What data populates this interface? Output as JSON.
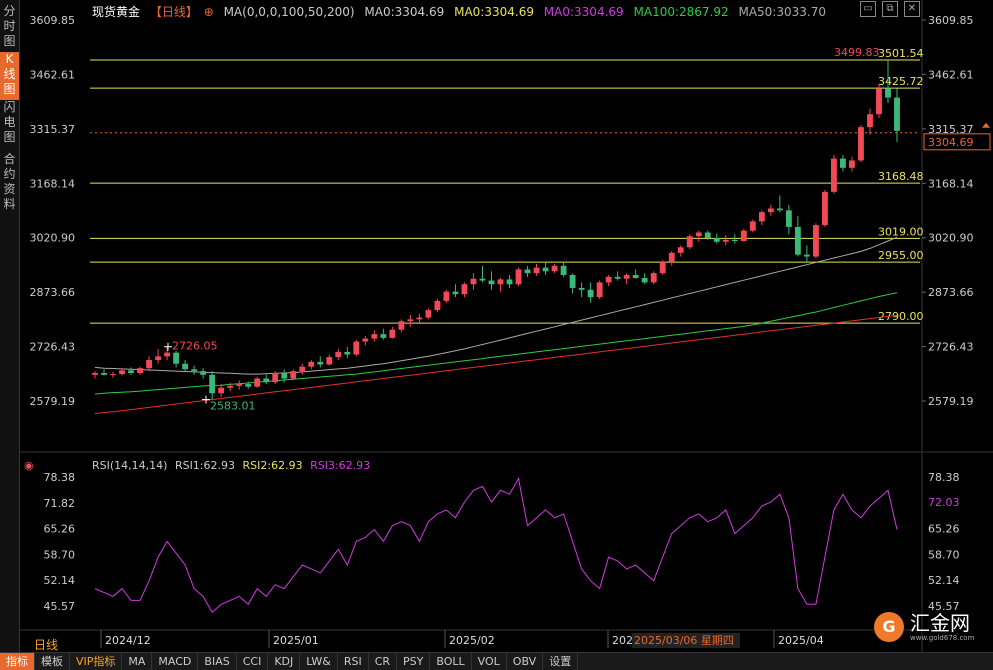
{
  "sidebar": {
    "tabs": [
      {
        "label": [
          "分",
          "时",
          "图"
        ],
        "active": false
      },
      {
        "label": [
          "K",
          "线",
          "图"
        ],
        "active": true
      },
      {
        "label": [
          "闪",
          "电",
          "图"
        ],
        "active": false
      },
      {
        "label": [
          "合",
          "约",
          "资",
          "料"
        ],
        "active": false
      }
    ]
  },
  "header": {
    "title": "现货黄金",
    "period": "【日线】",
    "ma_label": "MA(0,0,0,100,50,200)",
    "ma0": "MA0:3304.69",
    "ma0_yellow": "MA0:3304.69",
    "ma0_magenta": "MA0:3304.69",
    "ma100": "MA100:2867.92",
    "ma50": "MA50:3033.70"
  },
  "rsi_header": {
    "label": "RSI(14,14,14)",
    "rsi1": "RSI1:62.93",
    "rsi2": "RSI2:62.93",
    "rsi3": "RSI3:62.93"
  },
  "price_axis": [
    "3609.85",
    "3462.61",
    "3315.37",
    "3168.14",
    "3020.90",
    "2873.66",
    "2726.43",
    "2579.19"
  ],
  "rsi_axis": [
    "78.38",
    "71.82",
    "65.26",
    "58.70",
    "52.14",
    "45.57"
  ],
  "current_price": "3304.69",
  "current_rsi": "72.03",
  "date_axis": [
    "2024/12",
    "2025/01",
    "2025/02",
    "202",
    "2025/04"
  ],
  "crosshair_date": "2025/03/06 星期四",
  "levels": [
    "3501.54",
    "3425.72",
    "3168.48",
    "3019.00",
    "2955.00",
    "2790.00"
  ],
  "annotations": {
    "high_label": "2726.05",
    "low_label": "2583.01",
    "peak_label": "3499.83"
  },
  "period_label": "日线",
  "logo": {
    "name": "汇金网",
    "url": "www.gold678.com"
  },
  "bottom_bar": [
    "指标",
    "模板",
    "VIP指标",
    "MA",
    "MACD",
    "BIAS",
    "CCI",
    "KDJ",
    "LW&",
    "RSI",
    "CR",
    "PSY",
    "BOLL",
    "VOL",
    "OBV",
    "设置"
  ],
  "colors": {
    "up": "#f24957",
    "down": "#3bb87a",
    "level": "#e8e35a",
    "ma100": "#2ecc40",
    "ma200": "#e03030",
    "ma50": "#aaaaaa",
    "rsi": "#d13be0"
  },
  "chart_data": {
    "type": "candlestick",
    "candles": [
      [
        2650,
        2660,
        2640,
        2655
      ],
      [
        2655,
        2665,
        2648,
        2650
      ],
      [
        2650,
        2658,
        2642,
        2652
      ],
      [
        2652,
        2668,
        2648,
        2662
      ],
      [
        2662,
        2670,
        2650,
        2655
      ],
      [
        2655,
        2672,
        2650,
        2668
      ],
      [
        2668,
        2700,
        2660,
        2690
      ],
      [
        2690,
        2720,
        2680,
        2700
      ],
      [
        2700,
        2726,
        2690,
        2710
      ],
      [
        2710,
        2715,
        2670,
        2680
      ],
      [
        2680,
        2690,
        2660,
        2665
      ],
      [
        2665,
        2675,
        2650,
        2660
      ],
      [
        2660,
        2668,
        2640,
        2650
      ],
      [
        2650,
        2660,
        2583,
        2600
      ],
      [
        2600,
        2625,
        2590,
        2615
      ],
      [
        2615,
        2628,
        2605,
        2620
      ],
      [
        2620,
        2635,
        2610,
        2625
      ],
      [
        2625,
        2632,
        2612,
        2618
      ],
      [
        2618,
        2645,
        2615,
        2640
      ],
      [
        2640,
        2650,
        2625,
        2630
      ],
      [
        2630,
        2660,
        2625,
        2655
      ],
      [
        2655,
        2665,
        2630,
        2640
      ],
      [
        2640,
        2665,
        2635,
        2660
      ],
      [
        2660,
        2680,
        2650,
        2672
      ],
      [
        2672,
        2690,
        2665,
        2685
      ],
      [
        2685,
        2700,
        2670,
        2678
      ],
      [
        2678,
        2705,
        2675,
        2698
      ],
      [
        2698,
        2720,
        2690,
        2712
      ],
      [
        2712,
        2725,
        2695,
        2705
      ],
      [
        2705,
        2745,
        2700,
        2740
      ],
      [
        2740,
        2755,
        2730,
        2748
      ],
      [
        2748,
        2770,
        2740,
        2760
      ],
      [
        2760,
        2775,
        2745,
        2750
      ],
      [
        2750,
        2780,
        2748,
        2772
      ],
      [
        2772,
        2800,
        2765,
        2795
      ],
      [
        2795,
        2812,
        2780,
        2800
      ],
      [
        2800,
        2815,
        2790,
        2805
      ],
      [
        2805,
        2830,
        2800,
        2825
      ],
      [
        2825,
        2855,
        2820,
        2850
      ],
      [
        2850,
        2880,
        2845,
        2875
      ],
      [
        2875,
        2895,
        2860,
        2868
      ],
      [
        2868,
        2900,
        2860,
        2895
      ],
      [
        2895,
        2925,
        2880,
        2910
      ],
      [
        2910,
        2945,
        2900,
        2905
      ],
      [
        2905,
        2930,
        2880,
        2895
      ],
      [
        2895,
        2912,
        2875,
        2908
      ],
      [
        2908,
        2920,
        2885,
        2895
      ],
      [
        2895,
        2940,
        2890,
        2935
      ],
      [
        2935,
        2945,
        2915,
        2925
      ],
      [
        2925,
        2950,
        2918,
        2940
      ],
      [
        2940,
        2955,
        2920,
        2930
      ],
      [
        2930,
        2950,
        2925,
        2945
      ],
      [
        2945,
        2955,
        2915,
        2920
      ],
      [
        2920,
        2925,
        2870,
        2885
      ],
      [
        2885,
        2900,
        2860,
        2880
      ],
      [
        2880,
        2900,
        2845,
        2860
      ],
      [
        2860,
        2905,
        2855,
        2900
      ],
      [
        2900,
        2920,
        2890,
        2915
      ],
      [
        2915,
        2930,
        2905,
        2910
      ],
      [
        2910,
        2925,
        2895,
        2920
      ],
      [
        2920,
        2935,
        2910,
        2912
      ],
      [
        2912,
        2925,
        2895,
        2900
      ],
      [
        2900,
        2930,
        2895,
        2925
      ],
      [
        2925,
        2960,
        2920,
        2955
      ],
      [
        2955,
        2985,
        2945,
        2980
      ],
      [
        2980,
        3000,
        2970,
        2995
      ],
      [
        2995,
        3030,
        2990,
        3025
      ],
      [
        3025,
        3040,
        3010,
        3035
      ],
      [
        3035,
        3040,
        3015,
        3020
      ],
      [
        3020,
        3032,
        3005,
        3010
      ],
      [
        3010,
        3028,
        3000,
        3015
      ],
      [
        3015,
        3030,
        3005,
        3012
      ],
      [
        3012,
        3045,
        3010,
        3040
      ],
      [
        3040,
        3070,
        3035,
        3065
      ],
      [
        3065,
        3095,
        3055,
        3090
      ],
      [
        3090,
        3110,
        3080,
        3100
      ],
      [
        3100,
        3135,
        3090,
        3095
      ],
      [
        3095,
        3110,
        3030,
        3050
      ],
      [
        3050,
        3080,
        2970,
        2975
      ],
      [
        2975,
        3000,
        2955,
        2970
      ],
      [
        2970,
        3060,
        2965,
        3055
      ],
      [
        3055,
        3150,
        3050,
        3145
      ],
      [
        3145,
        3245,
        3140,
        3235
      ],
      [
        3235,
        3245,
        3200,
        3210
      ],
      [
        3210,
        3240,
        3200,
        3230
      ],
      [
        3230,
        3325,
        3225,
        3320
      ],
      [
        3320,
        3370,
        3300,
        3355
      ],
      [
        3355,
        3435,
        3345,
        3425
      ],
      [
        3425,
        3500,
        3385,
        3400
      ],
      [
        3400,
        3425,
        3280,
        3310
      ]
    ],
    "ma200": [
      2545,
      2548,
      2550,
      2553,
      2556,
      2559,
      2562,
      2565,
      2568,
      2571,
      2574,
      2577,
      2580,
      2583,
      2586,
      2589,
      2592,
      2595,
      2598,
      2601,
      2604,
      2607,
      2610,
      2613,
      2616,
      2619,
      2622,
      2625,
      2628,
      2631,
      2634,
      2637,
      2640,
      2643,
      2646,
      2649,
      2652,
      2655,
      2658,
      2661,
      2664,
      2667,
      2670,
      2673,
      2676,
      2679,
      2682,
      2685,
      2688,
      2691,
      2694,
      2697,
      2700,
      2703,
      2706,
      2709,
      2712,
      2715,
      2718,
      2721,
      2724,
      2727,
      2730,
      2733,
      2736,
      2739,
      2742,
      2745,
      2748,
      2751,
      2754,
      2757,
      2760,
      2763,
      2766,
      2769,
      2772,
      2775,
      2778,
      2781,
      2784,
      2787,
      2790,
      2793,
      2796,
      2799,
      2802,
      2805,
      2808,
      2811
    ],
    "ma100": [
      2598,
      2600,
      2602,
      2603,
      2604,
      2606,
      2608,
      2610,
      2612,
      2614,
      2616,
      2618,
      2620,
      2621,
      2622,
      2624,
      2626,
      2628,
      2630,
      2632,
      2634,
      2636,
      2638,
      2640,
      2642,
      2644,
      2646,
      2648,
      2650,
      2652,
      2655,
      2658,
      2661,
      2664,
      2667,
      2670,
      2673,
      2676,
      2679,
      2682,
      2685,
      2688,
      2691,
      2694,
      2697,
      2700,
      2703,
      2706,
      2709,
      2712,
      2715,
      2718,
      2721,
      2724,
      2727,
      2730,
      2733,
      2736,
      2739,
      2742,
      2745,
      2748,
      2751,
      2754,
      2757,
      2760,
      2763,
      2766,
      2769,
      2772,
      2775,
      2778,
      2781,
      2785,
      2790,
      2795,
      2800,
      2805,
      2810,
      2815,
      2820,
      2826,
      2832,
      2838,
      2844,
      2850,
      2856,
      2862,
      2867,
      2872
    ],
    "ma50": [
      2670,
      2668,
      2667,
      2666,
      2665,
      2664,
      2663,
      2662,
      2661,
      2660,
      2659,
      2658,
      2657,
      2656,
      2655,
      2654,
      2653,
      2652,
      2652,
      2653,
      2654,
      2655,
      2656,
      2658,
      2660,
      2662,
      2664,
      2666,
      2668,
      2671,
      2674,
      2677,
      2680,
      2684,
      2688,
      2692,
      2696,
      2700,
      2705,
      2710,
      2715,
      2720,
      2726,
      2732,
      2738,
      2744,
      2750,
      2756,
      2762,
      2768,
      2774,
      2780,
      2786,
      2792,
      2798,
      2804,
      2810,
      2816,
      2822,
      2828,
      2834,
      2840,
      2846,
      2852,
      2858,
      2864,
      2870,
      2876,
      2882,
      2888,
      2894,
      2900,
      2906,
      2912,
      2918,
      2924,
      2930,
      2936,
      2942,
      2948,
      2954,
      2960,
      2966,
      2972,
      2978,
      2984,
      2992,
      3002,
      3012,
      3022
    ],
    "rsi": [
      50,
      49,
      48,
      50,
      47,
      47,
      52,
      58,
      62,
      59,
      56,
      50,
      48,
      44,
      46,
      47,
      48,
      46,
      50,
      48,
      51,
      50,
      53,
      56,
      55,
      54,
      57,
      60,
      56,
      62,
      63,
      65,
      62,
      66,
      67,
      66,
      62,
      67,
      69,
      70,
      68,
      72,
      75,
      76,
      72,
      75,
      74,
      78,
      66,
      68,
      70,
      68,
      69,
      62,
      55,
      52,
      50,
      58,
      57,
      55,
      56,
      54,
      52,
      58,
      64,
      66,
      68,
      69,
      67,
      68,
      70,
      64,
      66,
      68,
      71,
      72,
      74,
      68,
      50,
      46,
      46,
      58,
      70,
      74,
      70,
      68,
      71,
      73,
      75,
      65
    ]
  }
}
